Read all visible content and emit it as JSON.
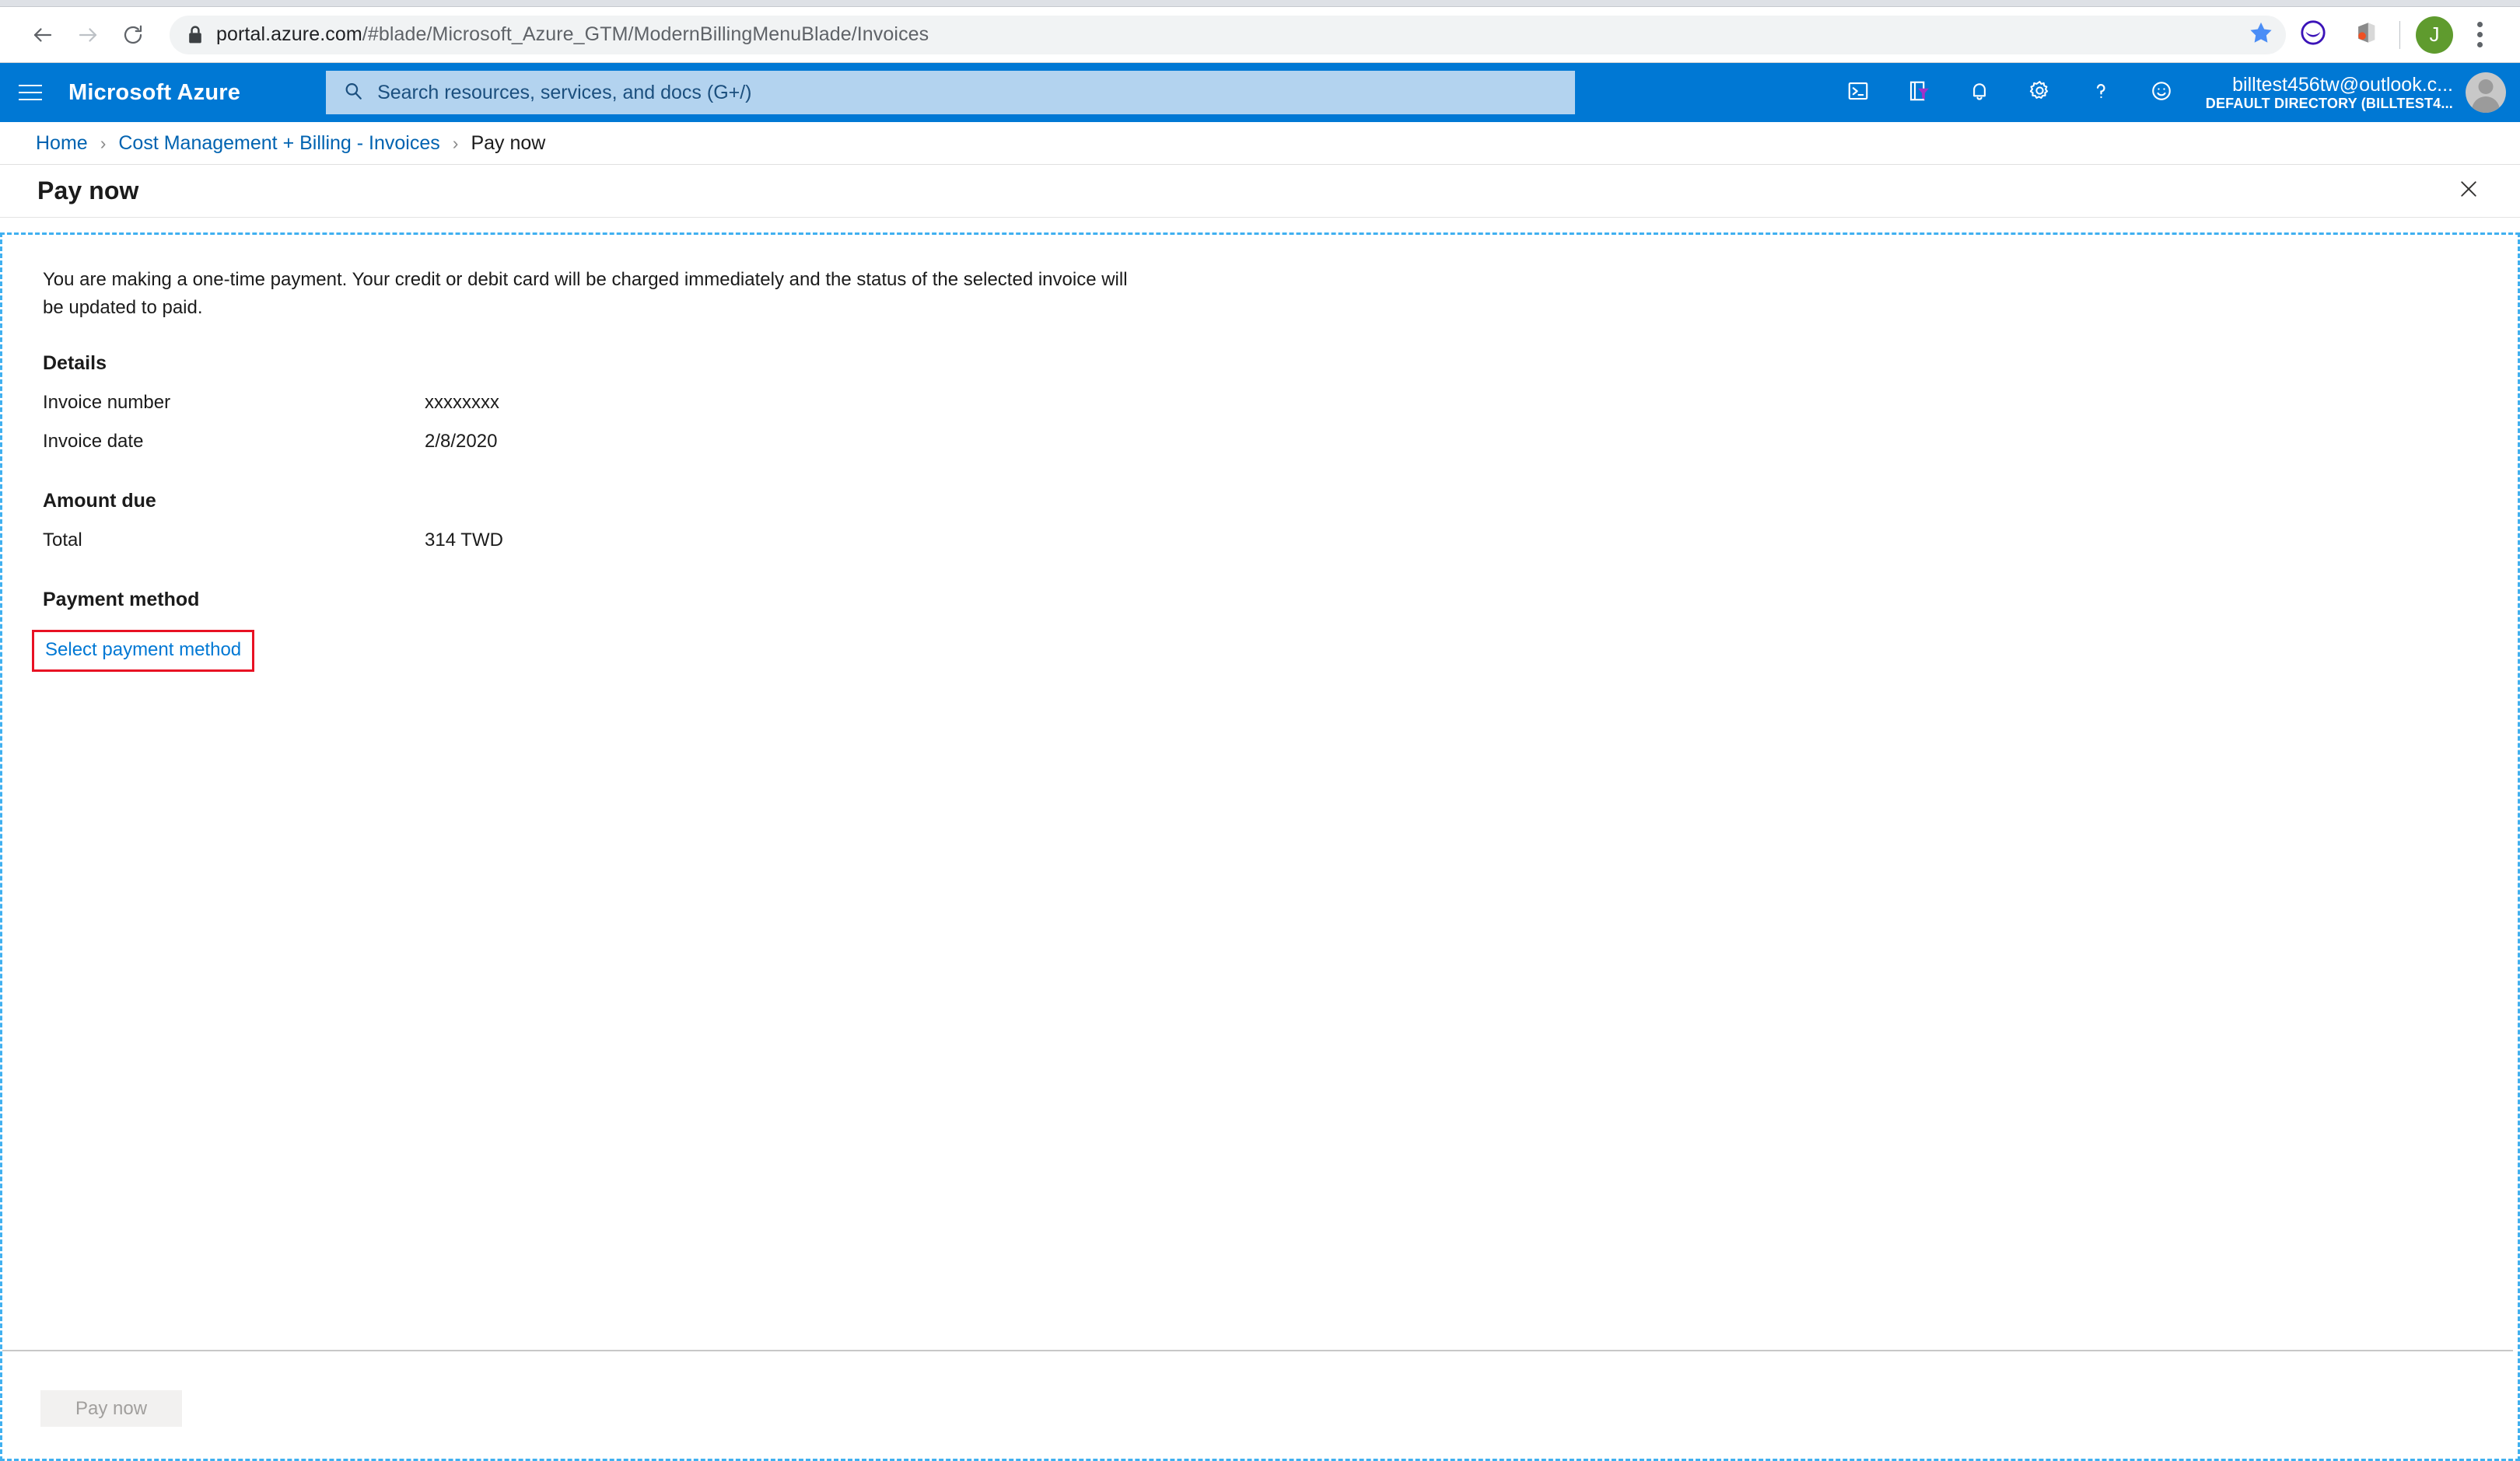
{
  "browser": {
    "back_icon": "back-arrow-icon",
    "forward_icon": "forward-arrow-icon",
    "reload_icon": "reload-icon",
    "lock_icon": "lock-icon",
    "url_domain": "portal.azure.com",
    "url_path": "/#blade/Microsoft_Azure_GTM/ModernBillingMenuBlade/Invoices",
    "url_full": "portal.azure.com/#blade/Microsoft_Azure_GTM/ModernBillingMenuBlade/Invoices",
    "star_icon": "bookmark-star-icon",
    "extension_icons": [
      "dark-reader-icon",
      "office-extension-icon"
    ],
    "profile_initial": "J",
    "menu_icon": "kebab-menu-icon",
    "colors": {
      "star": "#4a8df6",
      "profile_avatar": "#5f9b2e",
      "omnibox_bg": "#f1f3f4"
    }
  },
  "azure_header": {
    "menu_icon": "hamburger-menu-icon",
    "brand": "Microsoft Azure",
    "search": {
      "icon": "search-icon",
      "placeholder": "Search resources, services, and docs (G+/)"
    },
    "icons": [
      "cloud-shell-icon",
      "directory-filter-icon",
      "notifications-bell-icon",
      "settings-gear-icon",
      "help-question-icon",
      "feedback-smiley-icon"
    ],
    "account": {
      "email": "billtest456tw@outlook.c...",
      "directory": "DEFAULT DIRECTORY (BILLTEST4...",
      "avatar_icon": "user-avatar-icon"
    },
    "colors": {
      "bar": "#0078d4",
      "search_bg": "#b3d3ef"
    }
  },
  "breadcrumb": {
    "items": [
      {
        "label": "Home",
        "current": false
      },
      {
        "label": "Cost Management + Billing - Invoices",
        "current": false
      },
      {
        "label": "Pay now",
        "current": true
      }
    ],
    "separator": "›"
  },
  "blade": {
    "title": "Pay now",
    "close_icon": "close-icon"
  },
  "main": {
    "intro": "You are making a one-time payment. Your credit or debit card will be charged immediately and the status of the selected invoice will be updated to paid.",
    "details": {
      "heading": "Details",
      "rows": [
        {
          "label": "Invoice number",
          "value": "xxxxxxxx"
        },
        {
          "label": "Invoice date",
          "value": "2/8/2020"
        }
      ]
    },
    "amount_due": {
      "heading": "Amount due",
      "rows": [
        {
          "label": "Total",
          "value": "314 TWD"
        }
      ]
    },
    "payment_method": {
      "heading": "Payment method",
      "link_label": "Select payment method",
      "highlight_color": "#e81123",
      "link_color": "#0078d4"
    }
  },
  "footer": {
    "pay_now_label": "Pay now",
    "pay_now_disabled": true
  }
}
